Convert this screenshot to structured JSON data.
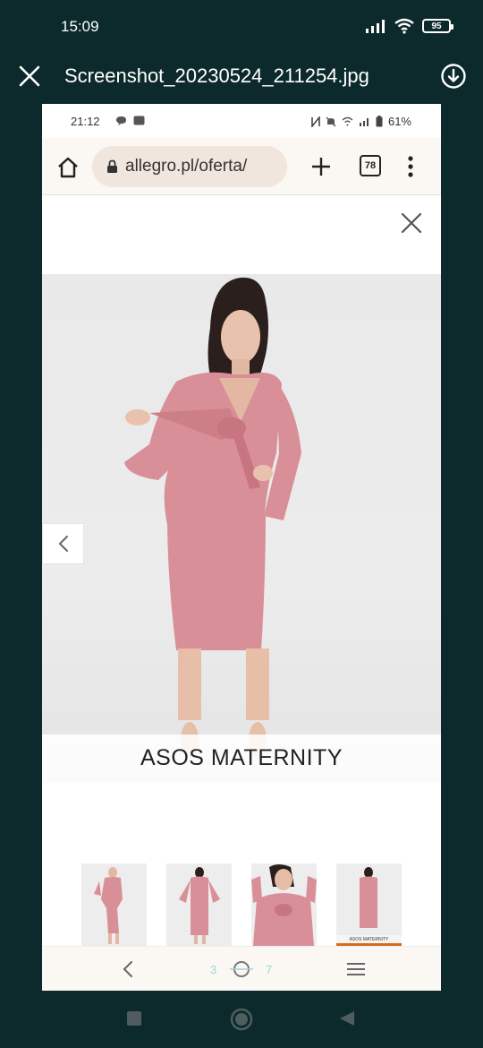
{
  "os_status": {
    "time": "15:09",
    "battery": "95"
  },
  "viewer": {
    "title": "Screenshot_20230524_211254.jpg",
    "close_icon": "close-icon",
    "download_icon": "download-icon"
  },
  "inner_status": {
    "time": "21:12",
    "battery_percent": "61%"
  },
  "browser": {
    "url": "allegro.pl/oferta/",
    "tab_count": "78"
  },
  "gallery": {
    "brand_caption": "ASOS MATERNITY",
    "thumb_caption": "ASOS MATERNITY",
    "current_page": "3",
    "total_pages": "7"
  },
  "colors": {
    "dress_pink": "#d98f97",
    "background_dark": "#0c2a2c",
    "active_thumb_indicator": "#d96a1d"
  }
}
